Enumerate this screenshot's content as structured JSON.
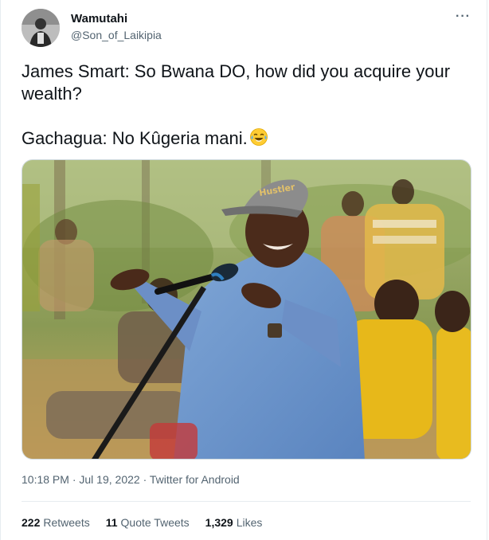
{
  "author": {
    "display_name": "Wamutahi",
    "handle": "@Son_of_Laikipia",
    "avatar_icon": "user-avatar"
  },
  "more_icon": "more-options-icon",
  "tweet": {
    "line1": "James Smart: So Bwana DO, how did you acquire your",
    "line2": "wealth?",
    "line3": "Gachagua: No Kûgeria mani.",
    "emoji_icon": "face-with-tears-of-joy"
  },
  "media": {
    "hat_text": "Hustler"
  },
  "meta": {
    "time": "10:18 PM",
    "date": "Jul 19, 2022",
    "source": "Twitter for Android",
    "sep": "·"
  },
  "stats": {
    "retweets_count": "222",
    "retweets_label": "Retweets",
    "quotes_count": "11",
    "quotes_label": "Quote Tweets",
    "likes_count": "1,329",
    "likes_label": "Likes"
  },
  "colors": {
    "text_primary": "#0f1419",
    "text_secondary": "#536471",
    "divider": "#e6ecf0"
  }
}
